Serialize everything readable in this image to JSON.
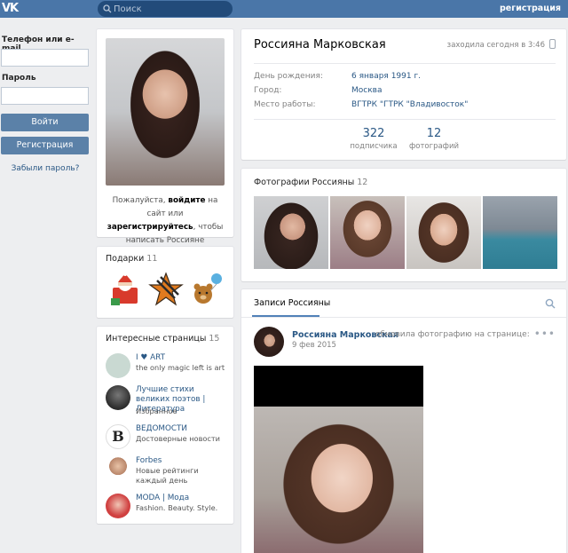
{
  "header": {
    "logo": "VK",
    "search_placeholder": "Поиск",
    "register_link": "регистрация"
  },
  "login": {
    "phone_label": "Телефон или e-mail",
    "password_label": "Пароль",
    "login_button": "Войти",
    "register_button": "Регистрация",
    "forgot_link": "Забыли пароль?"
  },
  "avatar_note": {
    "part1": "Пожалуйста, ",
    "login_word": "войдите",
    "part2": " на сайт или ",
    "register_word": "зарегистрируйтесь",
    "part3": ", чтобы написать Россияне сообщение."
  },
  "gifts": {
    "title": "Подарки",
    "count": "11"
  },
  "pages": {
    "title": "Интересные страницы",
    "count": "15",
    "items": [
      {
        "name": "I ♥ ART",
        "desc": "the only magic left is art",
        "color": "#c9d9d2"
      },
      {
        "name": "Лучшие стихи великих поэтов | Литература",
        "desc": "Избранное",
        "color": "#2b2b2b"
      },
      {
        "name": "ВЕДОМОСТИ",
        "desc": "Достоверные новости",
        "color": "#8a5a3a"
      },
      {
        "name": "Forbes",
        "desc": "Новые рейтинги каждый день",
        "color": "#6a4a3a"
      },
      {
        "name": "MODA | Мода",
        "desc": "Fashion. Beauty. Style.",
        "color": "#c43a3a"
      }
    ]
  },
  "profile": {
    "name": "Россияна Марковская",
    "status": "заходила сегодня в 3:46",
    "rows": [
      {
        "label": "День рождения:",
        "value": "6 января 1991 г."
      },
      {
        "label": "Город:",
        "value": "Москва"
      },
      {
        "label": "Место работы:",
        "value": "ВГТРК \"ГТРК \"Владивосток\""
      }
    ],
    "counters": [
      {
        "num": "322",
        "label": "подписчика"
      },
      {
        "num": "12",
        "label": "фотографий"
      }
    ]
  },
  "photos": {
    "title": "Фотографии Россияны",
    "count": "12"
  },
  "wall": {
    "tab": "Записи Россияны",
    "post": {
      "author": "Россияна Марковская",
      "action": "обновила фотографию на странице:",
      "date": "9 фев 2015",
      "more": "•••"
    }
  }
}
